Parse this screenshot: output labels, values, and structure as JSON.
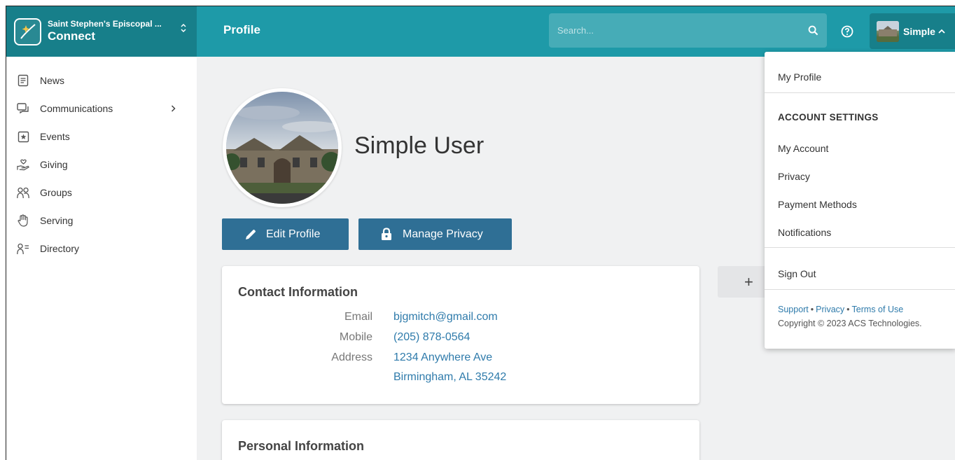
{
  "brand": {
    "org_name": "Saint Stephen's Episcopal ...",
    "app_name": "Connect"
  },
  "header": {
    "page_title": "Profile",
    "search_placeholder": "Search...",
    "user_short_name": "Simple"
  },
  "sidebar": {
    "items": [
      {
        "label": "News",
        "icon": "news-icon"
      },
      {
        "label": "Communications",
        "icon": "chat-icon",
        "has_submenu": true
      },
      {
        "label": "Events",
        "icon": "calendar-star-icon"
      },
      {
        "label": "Giving",
        "icon": "giving-hand-icon"
      },
      {
        "label": "Groups",
        "icon": "groups-icon"
      },
      {
        "label": "Serving",
        "icon": "raised-hand-icon"
      },
      {
        "label": "Directory",
        "icon": "directory-icon"
      }
    ]
  },
  "profile": {
    "name": "Simple User",
    "edit_button": "Edit Profile",
    "privacy_button": "Manage Privacy"
  },
  "contact": {
    "title": "Contact Information",
    "email_label": "Email",
    "email": "bjgmitch@gmail.com",
    "mobile_label": "Mobile",
    "mobile": "(205) 878-0564",
    "address_label": "Address",
    "address_line1": "1234 Anywhere Ave",
    "address_line2": "Birmingham, AL 35242"
  },
  "personal": {
    "title": "Personal Information"
  },
  "add_button": {
    "symbol": "+"
  },
  "dropdown": {
    "my_profile": "My Profile",
    "account_heading": "ACCOUNT SETTINGS",
    "my_account": "My Account",
    "privacy": "Privacy",
    "payment_methods": "Payment Methods",
    "notifications": "Notifications",
    "sign_out": "Sign Out",
    "footer_links": [
      "Support",
      "Privacy",
      "Terms of Use"
    ],
    "copyright": "Copyright © 2023 ACS Technologies."
  },
  "colors": {
    "header": "#1e9aa8",
    "brand_bg": "#177f8a",
    "button": "#2f6f95",
    "link": "#2f7bab"
  }
}
